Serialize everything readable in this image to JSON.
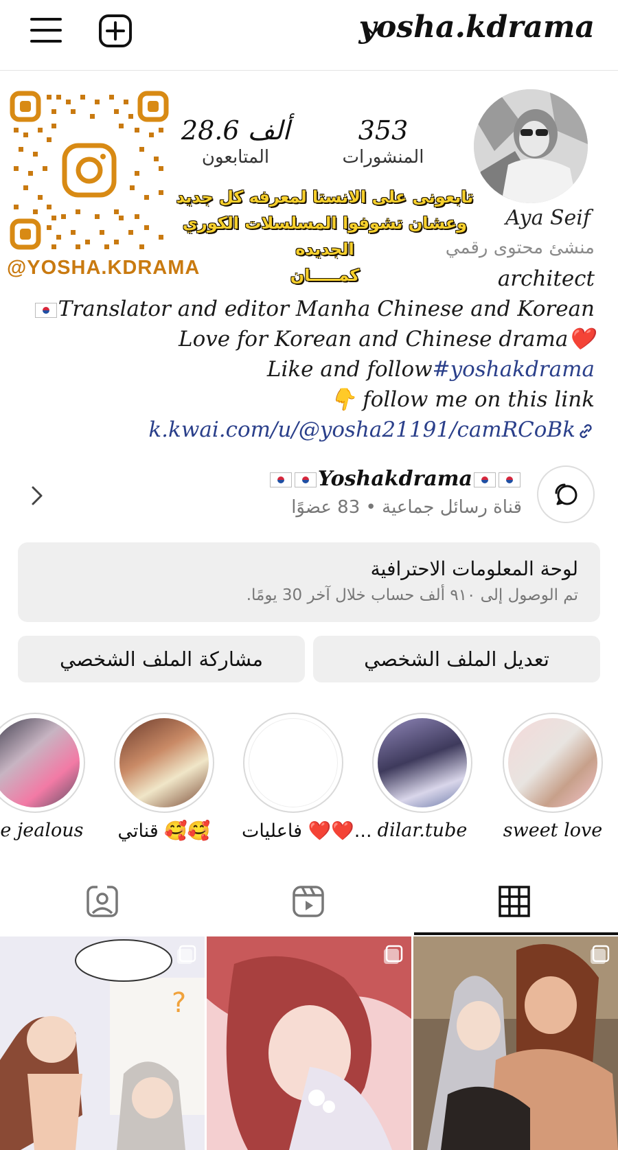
{
  "header": {
    "username": "yosha.kdrama"
  },
  "stats": {
    "posts_count": "353",
    "posts_label": "المنشورات",
    "followers_count": "28.6 ألف",
    "followers_label": "المتابعون"
  },
  "qr": {
    "handle": "@YOSHA.KDRAMA"
  },
  "promo": {
    "line1": "تابعونى على الانستا لمعرفه كل جديد",
    "line2": "وعشان تشوفوا المسلسلات الكوري الجديده",
    "line3": "كمـــــان"
  },
  "profile": {
    "name": "Aya Seif",
    "category": "منشئ محتوى رقمي"
  },
  "bio": {
    "line1": "architect",
    "line2": "Translator and editor Manha Chinese and Korean",
    "line3": "Love for Korean and Chinese drama❤️",
    "line4_prefix": "Like and follow",
    "line4_hashtag": "#yoshakdrama",
    "line5": "👇 follow me on this link",
    "link": "k.kwai.com/u/@yosha21191/camRCoBk"
  },
  "channel": {
    "title": "Yoshakdrama",
    "subtitle": "قناة رسائل جماعية • 83 عضوًا"
  },
  "dashboard": {
    "title": "لوحة المعلومات الاحترافية",
    "subtitle": "تم الوصول إلى ٩١٠ ألف حساب خلال آخر 30 يومًا."
  },
  "buttons": {
    "edit": "تعديل الملف الشخصي",
    "share": "مشاركة الملف الشخصي"
  },
  "highlights": [
    {
      "label": "sweet love"
    },
    {
      "label": "dilar.tube"
    },
    {
      "label": "فاعليات ❤️❤️..."
    },
    {
      "label": "قناتي 🥰🥰"
    },
    {
      "label": "Be jealous"
    }
  ],
  "tabs": {
    "active": "grid"
  },
  "colors": {
    "accent_link": "#2a3f8a",
    "qr_orange": "#c97a10",
    "promo_gold": "#f7d02c"
  }
}
